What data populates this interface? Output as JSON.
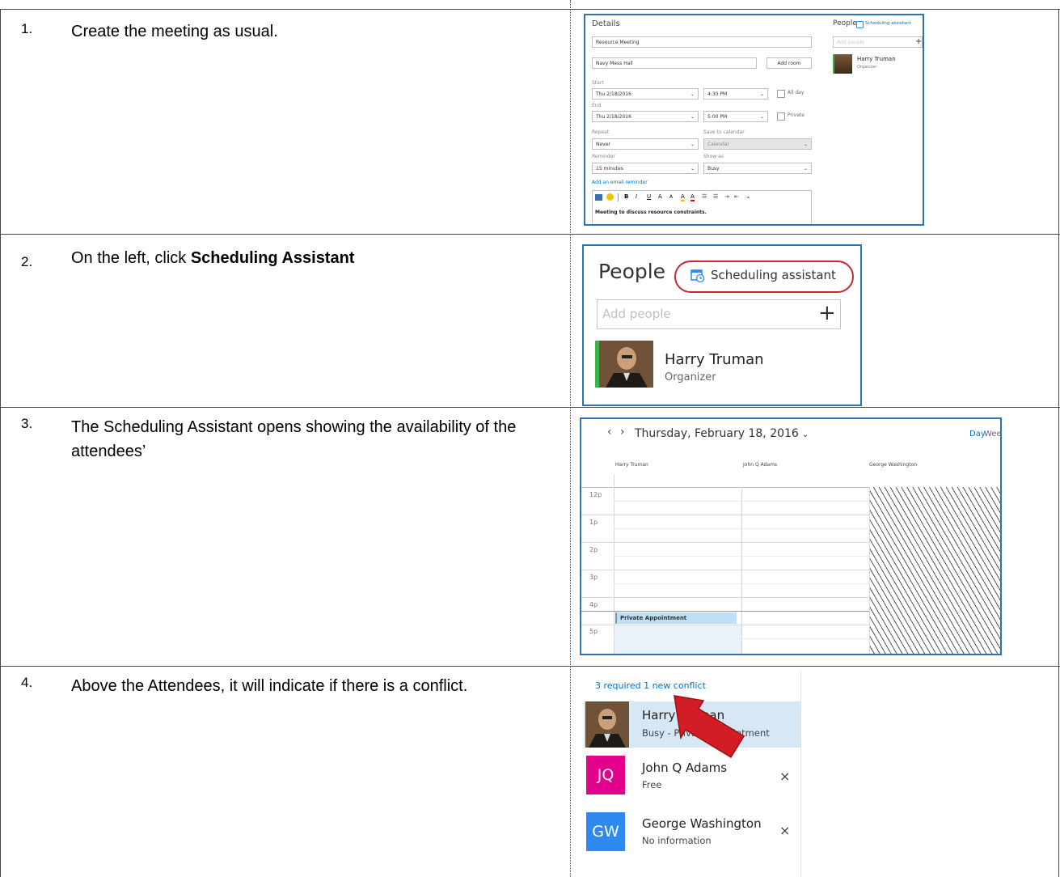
{
  "steps": [
    {
      "num": "1.",
      "text": "Create the meeting as usual."
    },
    {
      "num": "2.",
      "text_prefix": "On the left, click ",
      "text_bold": "Scheduling Assistant"
    },
    {
      "num": "3.",
      "text": "The Scheduling Assistant opens showing the availability of the attendees’"
    },
    {
      "num": "4.",
      "text": "Above the Attendees, it will indicate if there is a conflict."
    }
  ],
  "form": {
    "details_title": "Details",
    "subject": "Resource Meeting",
    "location": "Navy Mess Hall",
    "add_room": "Add room",
    "start_label": "Start",
    "start_date": "Thu 2/18/2016",
    "start_time": "4:30 PM",
    "all_day": "All day",
    "end_label": "End",
    "end_date": "Thu 2/18/2016",
    "end_time": "5:00 PM",
    "private": "Private",
    "repeat_label": "Repeat",
    "repeat_value": "Never",
    "save_label": "Save to calendar",
    "save_value": "Calendar",
    "reminder_label": "Reminder",
    "reminder_value": "15 minutes",
    "showas_label": "Show as",
    "showas_value": "Busy",
    "email_reminder": "Add an email reminder",
    "body_text": "Meeting to discuss resource constraints.",
    "toolbar_glyphs": [
      "B",
      "I",
      "U",
      "A",
      "A",
      "A",
      "A",
      "☰",
      "☰",
      "⇥",
      "⇤",
      "⌄"
    ],
    "people_title": "People",
    "sched_link": "Scheduling assistant",
    "add_people": "Add people",
    "organizer_name": "Harry Truman",
    "organizer_role": "Organizer"
  },
  "people_zoom": {
    "title": "People",
    "sched_link": "Scheduling assistant",
    "add_people": "Add people",
    "name": "Harry Truman",
    "role": "Organizer"
  },
  "sched": {
    "date_title": "Thursday, February 18, 2016",
    "view_day": "Day",
    "view_week": "Week",
    "attendees": [
      "Harry Truman",
      "John Q Adams",
      "George Washington"
    ],
    "hours": [
      "12p",
      "1p",
      "2p",
      "3p",
      "4p",
      "5p"
    ],
    "event": "Private Appointment"
  },
  "conflict": {
    "summary": "3 required 1 new conflict",
    "attendees": [
      {
        "name": "Harry Truman",
        "status": "Busy - Private Appointment",
        "initials": ""
      },
      {
        "name": "John Q Adams",
        "status": "Free",
        "initials": "JQ",
        "color": "#e3008c"
      },
      {
        "name": "George Washington",
        "status": "No information",
        "initials": "GW",
        "color": "#2d89ef"
      }
    ]
  }
}
